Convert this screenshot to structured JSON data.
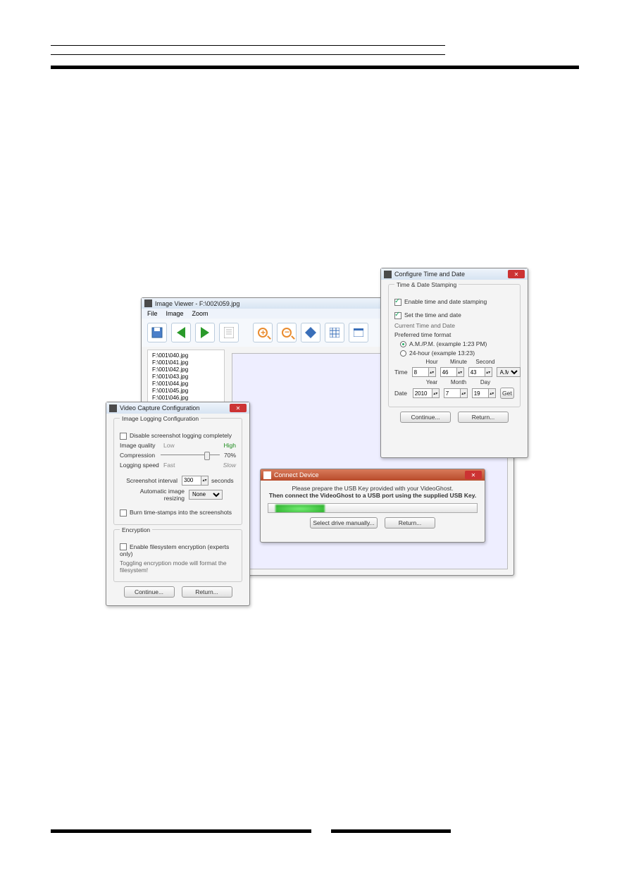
{
  "common": {
    "continue": "Continue...",
    "return": "Return..."
  },
  "imageViewer": {
    "title": "Image Viewer - F:\\002\\059.jpg",
    "menu": [
      "File",
      "Image",
      "Zoom"
    ],
    "files": [
      "F:\\001\\040.jpg",
      "F:\\001\\041.jpg",
      "F:\\001\\042.jpg",
      "F:\\001\\043.jpg",
      "F:\\001\\044.jpg",
      "F:\\001\\045.jpg",
      "F:\\001\\046.jpg"
    ]
  },
  "timeDate": {
    "title": "Configure Time and Date",
    "stampingGroup": "Time & Date Stamping",
    "enableStamping": "Enable time and date stamping",
    "setTimeDate": "Set the time and date",
    "currentLabel": "Current Time and Date",
    "preferredLabel": "Preferred time format",
    "ampmLabel": "A.M./P.M. (example 1:23 PM)",
    "h24Label": "24-hour (example 13:23)",
    "cols": [
      "Hour",
      "Minute",
      "Second"
    ],
    "cols2": [
      "Year",
      "Month",
      "Day"
    ],
    "timeLabel": "Time",
    "dateLabel": "Date",
    "hour": "8",
    "minute": "46",
    "second": "43",
    "ampm": "A.M.",
    "year": "2010",
    "month": "7",
    "day": "19",
    "getBtn": "Get"
  },
  "connect": {
    "title": "Connect Device",
    "line1": "Please prepare the USB Key provided with your VideoGhost.",
    "line2": "Then connect the VideoGhost to a USB port using the supplied USB Key.",
    "selectBtn": "Select drive manually..."
  },
  "capture": {
    "title": "Video Capture Configuration",
    "loggingGroup": "Image Logging Configuration",
    "disableLogging": "Disable screenshot logging completely",
    "qualityLabel": "Image quality",
    "low": "Low",
    "high": "High",
    "compressionLabel": "Compression",
    "compressionValue": "70%",
    "speedLabel": "Logging speed",
    "fast": "Fast",
    "slow": "Slow",
    "intervalLabel": "Screenshot interval",
    "intervalValue": "300",
    "seconds": "seconds",
    "resizeLabel": "Automatic image resizing",
    "resizeValue": "None",
    "burnTs": "Burn time-stamps into the screenshots",
    "encryptionGroup": "Encryption",
    "enableEnc": "Enable filesystem encryption (experts only)",
    "warning": "Toggling encryption mode will format the filesystem!"
  }
}
